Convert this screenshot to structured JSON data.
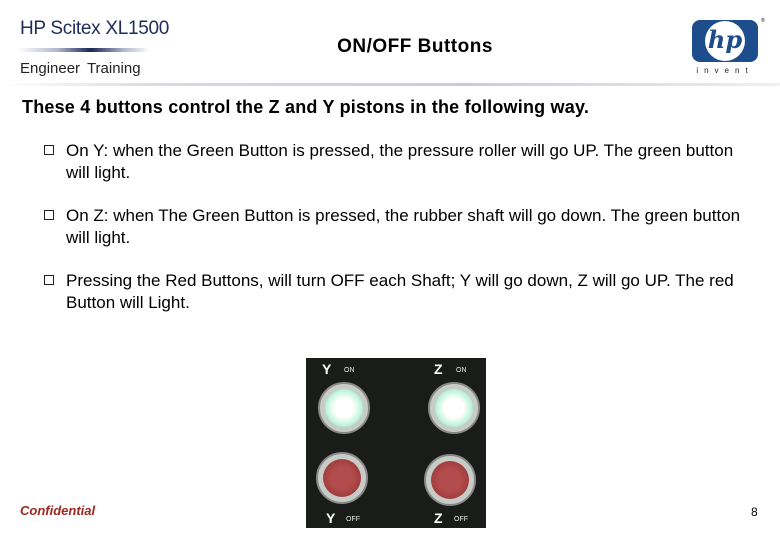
{
  "header": {
    "brand": "HP Scitex XL1500",
    "subtitle": "Engineer Training",
    "title": "ON/OFF Buttons",
    "logo_text": "hp",
    "logo_tagline": "invent"
  },
  "content": {
    "lead": "These 4 buttons control the Z and Y pistons in the following way.",
    "bullets": [
      {
        "text": "On Y: when the Green Button is pressed, the pressure roller will go UP. The green button will light."
      },
      {
        "text": "On Z: when The Green Button is pressed, the rubber shaft will go down. The green button will light."
      },
      {
        "text": "Pressing the Red Buttons, will turn OFF each Shaft; Y will go down, Z will go UP. The red Button will Light."
      }
    ]
  },
  "photo": {
    "labels": {
      "y_on_axis": "Y",
      "y_on_state": "ON",
      "z_on_axis": "Z",
      "z_on_state": "ON",
      "y_off_axis": "Y",
      "y_off_state": "OFF",
      "z_off_axis": "Z",
      "z_off_state": "OFF"
    },
    "colors": {
      "on_button": "#3ad1a0",
      "off_button": "#8f2f33"
    }
  },
  "footer": {
    "confidential": "Confidential",
    "page_number": "8"
  }
}
